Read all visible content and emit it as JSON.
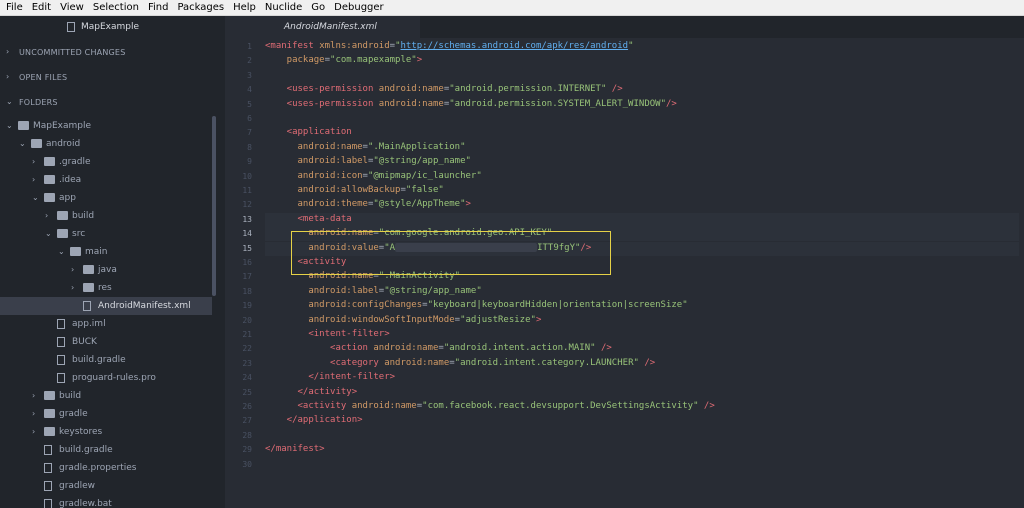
{
  "menu": [
    "File",
    "Edit",
    "View",
    "Selection",
    "Find",
    "Packages",
    "Help",
    "Nuclide",
    "Go",
    "Debugger"
  ],
  "sidebar": {
    "tab_title": "MapExample",
    "sections": [
      {
        "label": "UNCOMMITTED CHANGES",
        "expanded": false
      },
      {
        "label": "OPEN FILES",
        "expanded": false
      },
      {
        "label": "FOLDERS",
        "expanded": true
      }
    ],
    "tree": [
      {
        "name": "MapExample",
        "type": "folder",
        "expanded": true,
        "depth": 0
      },
      {
        "name": "android",
        "type": "folder",
        "expanded": true,
        "depth": 1
      },
      {
        "name": ".gradle",
        "type": "folder",
        "expanded": false,
        "depth": 2
      },
      {
        "name": ".idea",
        "type": "folder",
        "expanded": false,
        "depth": 2
      },
      {
        "name": "app",
        "type": "folder",
        "expanded": true,
        "depth": 2
      },
      {
        "name": "build",
        "type": "folder",
        "expanded": false,
        "depth": 3
      },
      {
        "name": "src",
        "type": "folder",
        "expanded": true,
        "depth": 3
      },
      {
        "name": "main",
        "type": "folder",
        "expanded": true,
        "depth": 4
      },
      {
        "name": "java",
        "type": "folder",
        "expanded": false,
        "depth": 5
      },
      {
        "name": "res",
        "type": "folder",
        "expanded": false,
        "depth": 5
      },
      {
        "name": "AndroidManifest.xml",
        "type": "file",
        "depth": 5,
        "selected": true
      },
      {
        "name": "app.iml",
        "type": "file",
        "depth": 3
      },
      {
        "name": "BUCK",
        "type": "file",
        "depth": 3
      },
      {
        "name": "build.gradle",
        "type": "file",
        "depth": 3
      },
      {
        "name": "proguard-rules.pro",
        "type": "file",
        "depth": 3
      },
      {
        "name": "build",
        "type": "folder",
        "expanded": false,
        "depth": 2
      },
      {
        "name": "gradle",
        "type": "folder",
        "expanded": false,
        "depth": 2
      },
      {
        "name": "keystores",
        "type": "folder",
        "expanded": false,
        "depth": 2
      },
      {
        "name": "build.gradle",
        "type": "file",
        "depth": 2
      },
      {
        "name": "gradle.properties",
        "type": "file",
        "depth": 2
      },
      {
        "name": "gradlew",
        "type": "file",
        "depth": 2
      },
      {
        "name": "gradlew.bat",
        "type": "file",
        "depth": 2
      }
    ]
  },
  "editor": {
    "tab_title": "AndroidManifest.xml",
    "current_lines": [
      13,
      14,
      15
    ],
    "lines": [
      [
        [
          "tag",
          "<manifest "
        ],
        [
          "attr",
          "xmlns:android"
        ],
        [
          "pun",
          "="
        ],
        [
          "str",
          "\""
        ],
        [
          "url",
          "http://schemas.android.com/apk/res/android"
        ],
        [
          "str",
          "\""
        ]
      ],
      [
        [
          "attr",
          "    package"
        ],
        [
          "pun",
          "="
        ],
        [
          "str",
          "\"com.mapexample\""
        ],
        [
          "tag",
          ">"
        ]
      ],
      [],
      [
        [
          "tag",
          "    <uses-permission "
        ],
        [
          "attr",
          "android:name"
        ],
        [
          "pun",
          "="
        ],
        [
          "str",
          "\"android.permission.INTERNET\""
        ],
        [
          "tag",
          " />"
        ]
      ],
      [
        [
          "tag",
          "    <uses-permission "
        ],
        [
          "attr",
          "android:name"
        ],
        [
          "pun",
          "="
        ],
        [
          "str",
          "\"android.permission.SYSTEM_ALERT_WINDOW\""
        ],
        [
          "tag",
          "/>"
        ]
      ],
      [],
      [
        [
          "tag",
          "    <application"
        ]
      ],
      [
        [
          "attr",
          "      android:name"
        ],
        [
          "pun",
          "="
        ],
        [
          "str",
          "\".MainApplication\""
        ]
      ],
      [
        [
          "attr",
          "      android:label"
        ],
        [
          "pun",
          "="
        ],
        [
          "str",
          "\"@string/app_name\""
        ]
      ],
      [
        [
          "attr",
          "      android:icon"
        ],
        [
          "pun",
          "="
        ],
        [
          "str",
          "\"@mipmap/ic_launcher\""
        ]
      ],
      [
        [
          "attr",
          "      android:allowBackup"
        ],
        [
          "pun",
          "="
        ],
        [
          "str",
          "\"false\""
        ]
      ],
      [
        [
          "attr",
          "      android:theme"
        ],
        [
          "pun",
          "="
        ],
        [
          "str",
          "\"@style/AppTheme\""
        ],
        [
          "tag",
          ">"
        ]
      ],
      [
        [
          "tag",
          "      <meta-data"
        ]
      ],
      [
        [
          "attr",
          "        android:name"
        ],
        [
          "pun",
          "="
        ],
        [
          "str",
          "\"com.google.android.geo.API_KEY\""
        ]
      ],
      [
        [
          "attr",
          "        android:value"
        ],
        [
          "pun",
          "="
        ],
        [
          "str",
          "\"A"
        ],
        [
          "blur",
          ""
        ],
        [
          "str",
          "ITT9fgY\""
        ],
        [
          "tag",
          "/>"
        ]
      ],
      [
        [
          "tag",
          "      <activity"
        ]
      ],
      [
        [
          "attr",
          "        android:name"
        ],
        [
          "pun",
          "="
        ],
        [
          "str",
          "\".MainActivity\""
        ]
      ],
      [
        [
          "attr",
          "        android:label"
        ],
        [
          "pun",
          "="
        ],
        [
          "str",
          "\"@string/app_name\""
        ]
      ],
      [
        [
          "attr",
          "        android:configChanges"
        ],
        [
          "pun",
          "="
        ],
        [
          "str",
          "\"keyboard|keyboardHidden|orientation|screenSize\""
        ]
      ],
      [
        [
          "attr",
          "        android:windowSoftInputMode"
        ],
        [
          "pun",
          "="
        ],
        [
          "str",
          "\"adjustResize\""
        ],
        [
          "tag",
          ">"
        ]
      ],
      [
        [
          "tag",
          "        <intent-filter>"
        ]
      ],
      [
        [
          "tag",
          "            <action "
        ],
        [
          "attr",
          "android:name"
        ],
        [
          "pun",
          "="
        ],
        [
          "str",
          "\"android.intent.action.MAIN\""
        ],
        [
          "tag",
          " />"
        ]
      ],
      [
        [
          "tag",
          "            <category "
        ],
        [
          "attr",
          "android:name"
        ],
        [
          "pun",
          "="
        ],
        [
          "str",
          "\"android.intent.category.LAUNCHER\""
        ],
        [
          "tag",
          " />"
        ]
      ],
      [
        [
          "tag",
          "        </intent-filter>"
        ]
      ],
      [
        [
          "tag",
          "      </activity>"
        ]
      ],
      [
        [
          "tag",
          "      <activity "
        ],
        [
          "attr",
          "android:name"
        ],
        [
          "pun",
          "="
        ],
        [
          "str",
          "\"com.facebook.react.devsupport.DevSettingsActivity\""
        ],
        [
          "tag",
          " />"
        ]
      ],
      [
        [
          "tag",
          "    </application>"
        ]
      ],
      [],
      [
        [
          "tag",
          "</manifest>"
        ]
      ],
      []
    ]
  },
  "colors": {
    "accent": "#e5d147",
    "bg": "#282c34",
    "sidebar": "#21252b"
  }
}
